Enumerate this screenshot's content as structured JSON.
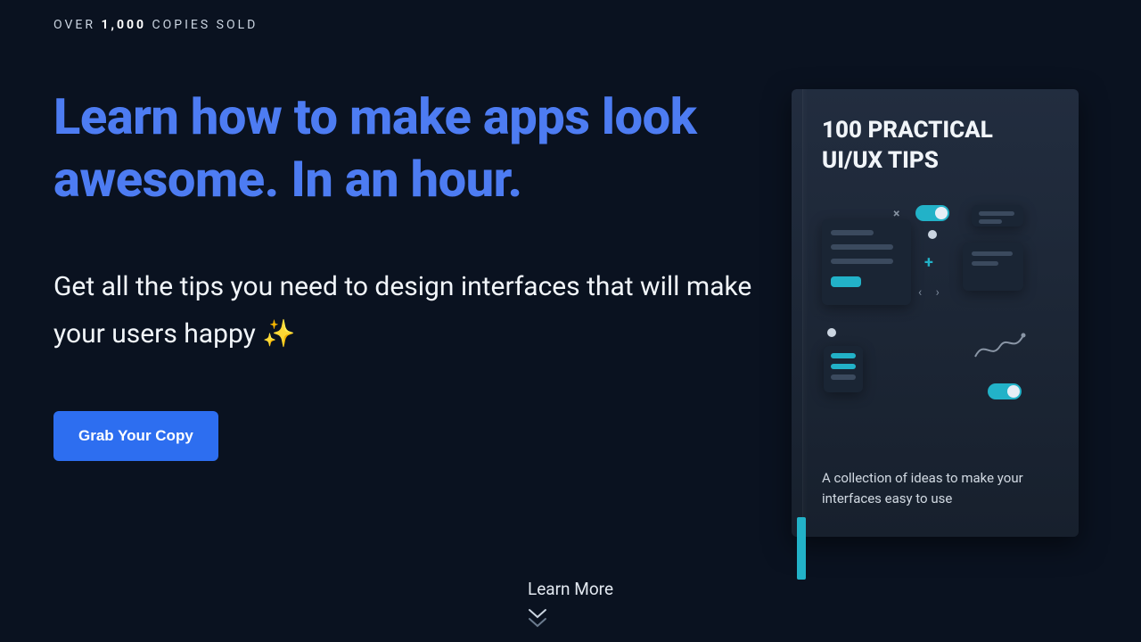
{
  "badge": {
    "pre": "OVER",
    "count": "1,000",
    "post": "COPIES SOLD"
  },
  "hero": {
    "title": "Learn how to make apps look awesome. In an hour."
  },
  "subtitle": "Get all the tips you need to design interfaces that will make your users happy ✨",
  "cta": {
    "label": "Grab Your Copy"
  },
  "learn_more": "Learn More",
  "book": {
    "title": "100 PRACTICAL UI/UX TIPS",
    "subtitle": "A collection of ideas to make your interfaces easy to use"
  }
}
